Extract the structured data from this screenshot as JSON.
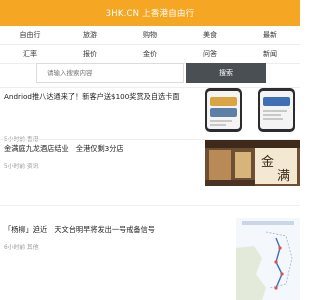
{
  "header": {
    "title": "3HK.CN 上香港自由行"
  },
  "nav": {
    "row1": [
      "自由行",
      "旅游",
      "购物",
      "美食",
      "最新"
    ],
    "row2": [
      "汇率",
      "报价",
      "金价",
      "问答",
      "新闻"
    ]
  },
  "search": {
    "placeholder": "请输入搜索内容",
    "button_label": "搜索"
  },
  "articles": [
    {
      "title": "Andriod推八达通来了！新客户送$100奖赏及自选卡面",
      "meta": "5小时前 香港",
      "image": "phone-screenshots"
    },
    {
      "title": "金满庭九龙酒店结业　全港仅剩3分店",
      "meta": "5小时前 资讯",
      "image": "hotel-interior"
    },
    {
      "title": "「杨柳」迫近　天文台明早将发出一号戒备信号",
      "meta": "6小时前 其他",
      "image": "typhoon-track-map"
    }
  ],
  "colors": {
    "header_bg": "#f5a623",
    "search_button_bg": "#4a4f53"
  }
}
